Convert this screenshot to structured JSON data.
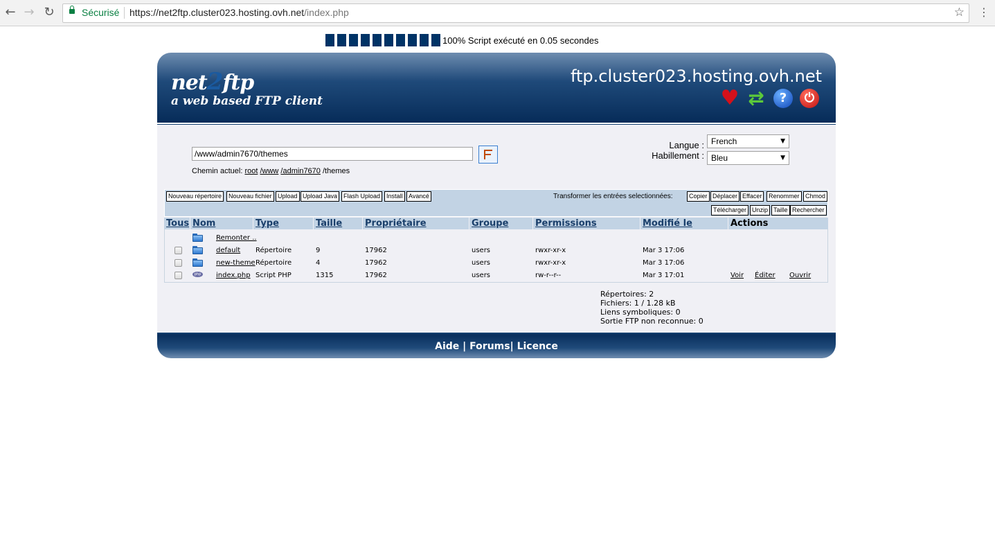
{
  "browser": {
    "secure_label": "Sécurisé",
    "url_host": "https://net2ftp.cluster023.hosting.ovh.net",
    "url_path": "/index.php"
  },
  "progress": {
    "percent": 100,
    "blocks": 10,
    "text": "100% Script exécuté en 0.05 secondes"
  },
  "header": {
    "logo_pre": "net",
    "logo_two": "2",
    "logo_post": "ftp",
    "tagline": "a web based FTP client",
    "hostname": "ftp.cluster023.hosting.ovh.net",
    "icons": [
      "heart-icon",
      "refresh-icon",
      "help-icon",
      "logout-icon"
    ]
  },
  "directory": {
    "value": "/www/admin7670/themes",
    "current_label": "Chemin actuel:",
    "crumbs": [
      "root",
      "/www",
      "/admin7670",
      "/themes"
    ]
  },
  "settings": {
    "language_label": "Langue :",
    "language_value": "French",
    "skin_label": "Habillement :",
    "skin_value": "Bleu"
  },
  "toolbar": {
    "left_buttons": [
      "Nouveau répertoire",
      "Nouveau fichier",
      "Upload",
      "Upload Java",
      "Flash Upload",
      "Install",
      "Avancé"
    ],
    "transform_label": "Transformer les entrées selectionnées:",
    "right_buttons_row1": [
      "Copier",
      "Déplacer",
      "Effacer",
      "Renommer",
      "Chmod"
    ],
    "right_buttons_row2": [
      "Télécharger",
      "Unzip",
      "Taille",
      "Rechercher"
    ]
  },
  "table": {
    "headers": [
      "Tous",
      "Nom",
      "Type",
      "Taille",
      "Propriétaire",
      "Groupe",
      "Permissions",
      "Modifié le",
      "Actions"
    ],
    "up_label": "Remonter ..",
    "rows": [
      {
        "name": "default",
        "type": "Répertoire",
        "size": "9",
        "owner": "17962",
        "group": "users",
        "perms": "rwxr-xr-x",
        "modified": "Mar 3 17:06",
        "icon": "folder-icon"
      },
      {
        "name": "new-theme",
        "type": "Répertoire",
        "size": "4",
        "owner": "17962",
        "group": "users",
        "perms": "rwxr-xr-x",
        "modified": "Mar 3 17:06",
        "icon": "folder-icon"
      },
      {
        "name": "index.php",
        "type": "Script PHP",
        "size": "1315",
        "owner": "17962",
        "group": "users",
        "perms": "rw-r--r--",
        "modified": "Mar 3 17:01",
        "icon": "php-file-icon",
        "actions": [
          "Voir",
          "Éditer",
          "Ouvrir"
        ]
      }
    ]
  },
  "stats": {
    "dirs": "Répertoires: 2",
    "files": "Fichiers: 1 / 1.28 kB",
    "links": "Liens symboliques: 0",
    "unrecognized": "Sortie FTP non reconnue: 0"
  },
  "footer": {
    "aide": "Aide",
    "sep1": " | ",
    "forums": "Forums",
    "sep2": "| ",
    "licence": "Licence"
  }
}
